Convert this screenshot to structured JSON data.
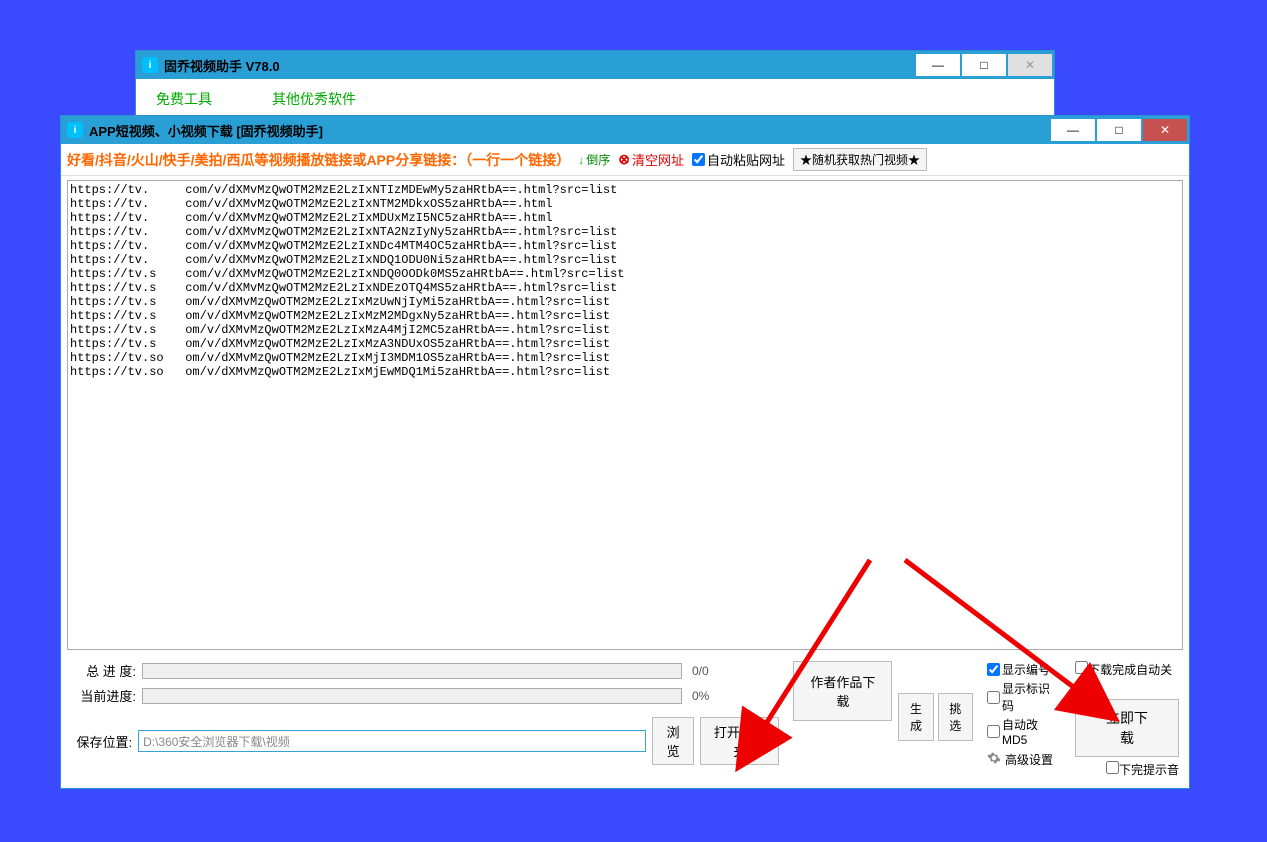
{
  "back_window": {
    "title": "固乔视频助手 V78.0",
    "links": [
      "免费工具",
      "其他优秀软件"
    ]
  },
  "front_window": {
    "title": "APP短视频、小视频下载 [固乔视频助手]",
    "toolbar": {
      "main_label": "好看/抖音/火山/快手/美拍/西瓜等视频播放链接或APP分享链接：（一行一个链接）",
      "sort_label": "倒序",
      "clear_label": "清空网址",
      "auto_paste_label": "自动粘贴网址",
      "auto_paste_checked": true,
      "random_button": "★随机获取热门视频★"
    },
    "urls_text": "https://tv.     com/v/dXMvMzQwOTM2MzE2LzIxNTIzMDEwMy5zaHRtbA==.html?src=list\nhttps://tv.     com/v/dXMvMzQwOTM2MzE2LzIxNTM2MDkxOS5zaHRtbA==.html\nhttps://tv.     com/v/dXMvMzQwOTM2MzE2LzIxMDUxMzI5NC5zaHRtbA==.html\nhttps://tv.     com/v/dXMvMzQwOTM2MzE2LzIxNTA2NzIyNy5zaHRtbA==.html?src=list\nhttps://tv.     com/v/dXMvMzQwOTM2MzE2LzIxNDc4MTM4OC5zaHRtbA==.html?src=list\nhttps://tv.     com/v/dXMvMzQwOTM2MzE2LzIxNDQ1ODU0Ni5zaHRtbA==.html?src=list\nhttps://tv.s    com/v/dXMvMzQwOTM2MzE2LzIxNDQ0OODk0MS5zaHRtbA==.html?src=list\nhttps://tv.s    com/v/dXMvMzQwOTM2MzE2LzIxNDEzOTQ4MS5zaHRtbA==.html?src=list\nhttps://tv.s    om/v/dXMvMzQwOTM2MzE2LzIxMzUwNjIyMi5zaHRtbA==.html?src=list\nhttps://tv.s    om/v/dXMvMzQwOTM2MzE2LzIxMzM2MDgxNy5zaHRtbA==.html?src=list\nhttps://tv.s    om/v/dXMvMzQwOTM2MzE2LzIxMzA4MjI2MC5zaHRtbA==.html?src=list\nhttps://tv.s    om/v/dXMvMzQwOTM2MzE2LzIxMzA3NDUxOS5zaHRtbA==.html?src=list\nhttps://tv.so   om/v/dXMvMzQwOTM2MzE2LzIxMjI3MDM1OS5zaHRtbA==.html?src=list\nhttps://tv.so   om/v/dXMvMzQwOTM2MzE2LzIxMjEwMDQ1Mi5zaHRtbA==.html?src=list",
    "progress": {
      "total_label": "总 进 度:",
      "total_text": "0/0",
      "current_label": "当前进度:",
      "current_text": "0%"
    },
    "save": {
      "label": "保存位置:",
      "path": "D:\\360安全浏览器下载\\视频",
      "browse": "浏览",
      "open_folder": "打开文件夹"
    },
    "buttons": {
      "author_download": "作者作品下载",
      "generate": "生成",
      "select": "挑选",
      "advanced": "高级设置",
      "download_now": "立即下载"
    },
    "checkboxes": {
      "show_number": "显示编号",
      "show_number_checked": true,
      "show_identifier": "显示标识码",
      "show_identifier_checked": false,
      "auto_md5": "自动改MD5",
      "auto_md5_checked": false,
      "shutdown_after": "下载完成自动关机",
      "shutdown_after_checked": false,
      "sound_after": "下完提示音",
      "sound_after_checked": false
    }
  }
}
